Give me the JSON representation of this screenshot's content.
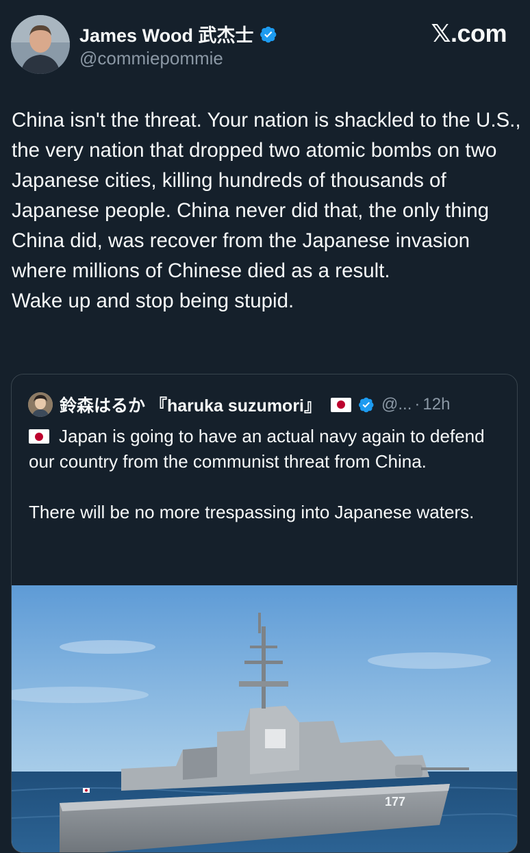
{
  "author": {
    "name": "James Wood 武杰士",
    "handle": "@commiepommie",
    "verified": true,
    "avatar_icon": "user-avatar"
  },
  "site_logo": "𝕏.com",
  "tweet": {
    "text": "China isn't the threat. Your nation is shackled to the U.S., the very nation that dropped two atomic bombs on two Japanese cities, killing hundreds of thousands of Japanese people. China never did that, the only thing China did, was recover from the Japanese invasion where millions of Chinese died as a result.\nWake up and stop being stupid."
  },
  "quoted_tweet": {
    "name": "鈴森はるか 『haruka suzumori』",
    "flag_icon": "japan-flag-icon",
    "verified": true,
    "handle": "@...",
    "separator": "·",
    "time": "12h",
    "paragraphs": [
      "Japan is going to have an actual navy again to defend our country from the communist threat from China.",
      "There will be no more trespassing into Japanese waters."
    ],
    "media": {
      "hull_number": "177"
    }
  },
  "colors": {
    "background": "#15202b",
    "text": "#f7f9f9",
    "secondary_text": "#8b98a5",
    "border": "#38444d",
    "verified": "#1d9bf0"
  }
}
